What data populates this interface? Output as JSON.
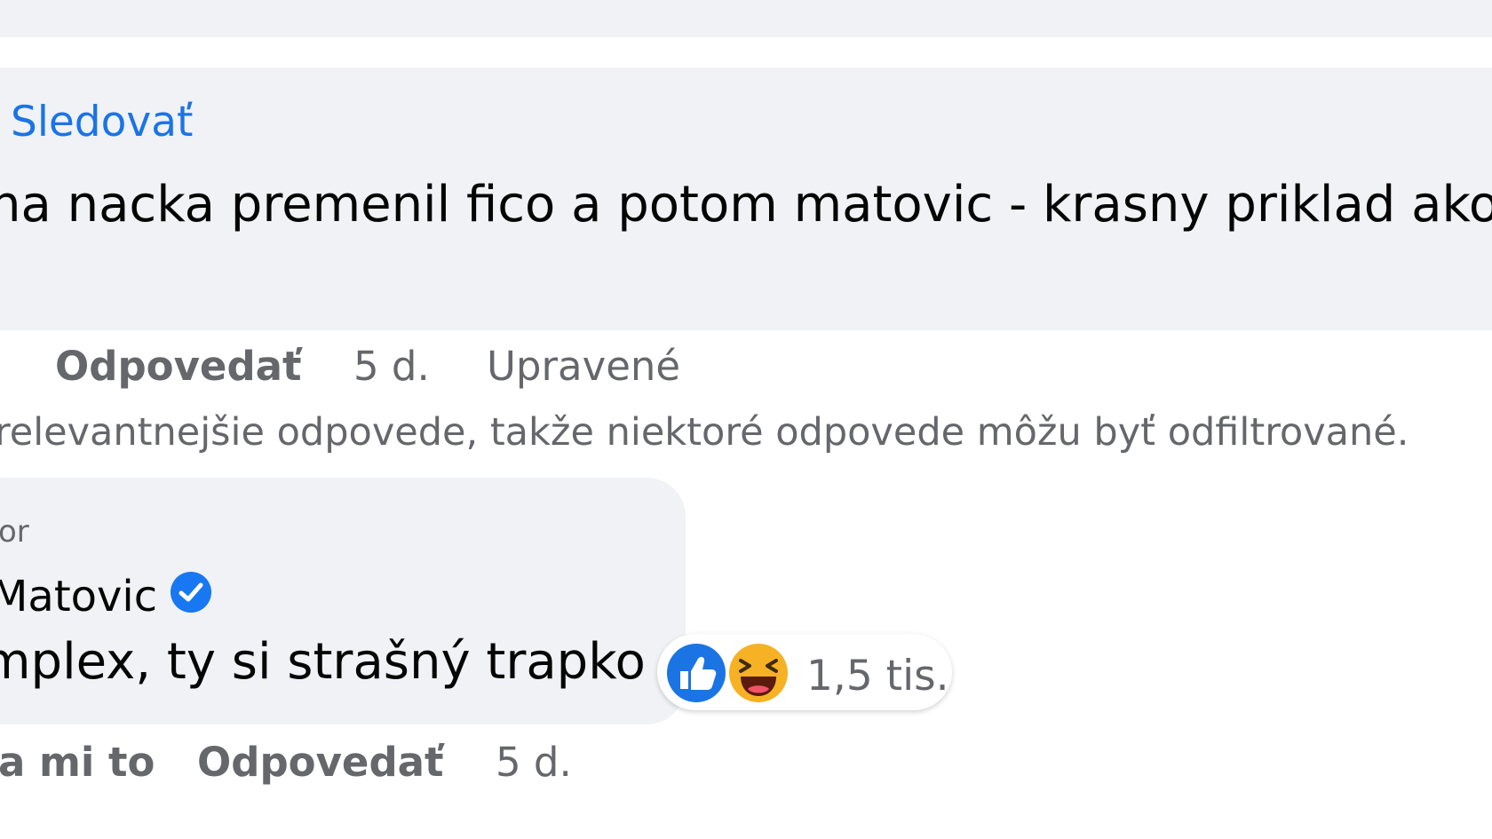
{
  "comment": {
    "follow_label": "Sledovať",
    "text_line1": "na nacka premenil fico a potom matovic - krasny priklad ako n",
    "text_line2": ".",
    "reply_label": "Odpovedať",
    "time": "5 d.",
    "edited_label": "Upravené"
  },
  "filter_note": "relevantnejšie odpovede, takže niektoré odpovede môžu byť odfiltrované.",
  "reply": {
    "author_tag": "or",
    "author_name": "Matovic",
    "verified_icon": "verified-badge-icon",
    "text": "mplex, ty si strašný trapko",
    "reactions": {
      "icons": [
        "like-reaction-icon",
        "haha-reaction-icon"
      ],
      "count": "1,5 tis."
    },
    "like_label": "a mi to",
    "reply_label": "Odpovedať",
    "time": "5 d."
  },
  "colors": {
    "link": "#1b74e4",
    "bubble": "#f0f2f5",
    "secondary_text": "#65676b",
    "verified": "#1877f2",
    "haha": "#f7b125"
  }
}
